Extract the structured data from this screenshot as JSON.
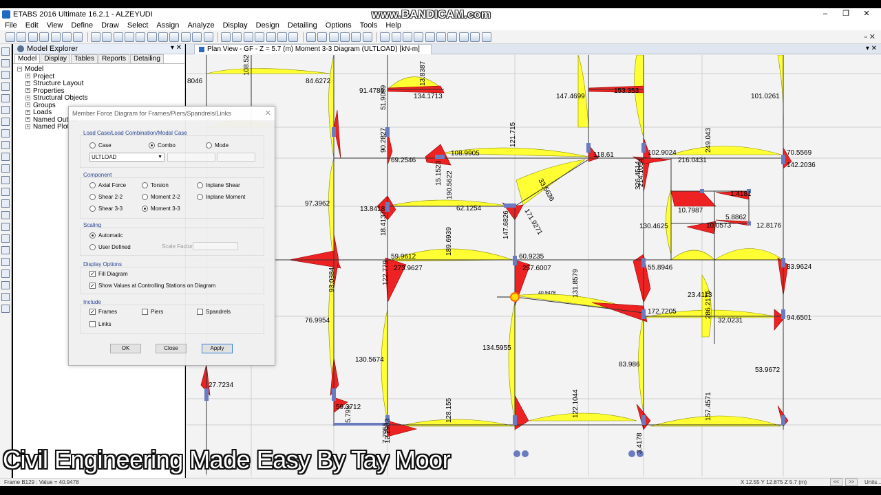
{
  "app": {
    "title": "ETABS 2016 Ultimate 16.2.1 - ALZEYUDI",
    "watermark": "www.BANDICAM.com",
    "window_controls": [
      "–",
      "❐",
      "✕"
    ]
  },
  "menu": [
    "File",
    "Edit",
    "View",
    "Define",
    "Draw",
    "Select",
    "Assign",
    "Analyze",
    "Display",
    "Design",
    "Detailing",
    "Options",
    "Tools",
    "Help"
  ],
  "explorer": {
    "title": "Model Explorer",
    "tabs": [
      "Model",
      "Display",
      "Tables",
      "Reports",
      "Detailing"
    ],
    "root": "Model",
    "items": [
      "Project",
      "Structure Layout",
      "Properties",
      "Structural Objects",
      "Groups",
      "Loads",
      "Named Output",
      "Named Plots"
    ]
  },
  "doc_tab": {
    "title": "Plan View - GF - Z = 5.7 (m)   Moment 3-3 Diagram   (ULTLOAD)  [kN-m]"
  },
  "dialog": {
    "title": "Member Force Diagram for Frames/Piers/Spandrels/Links",
    "load_case_group": "Load Case/Load Combination/Modal Case",
    "case_options": [
      "Case",
      "Combo",
      "Mode"
    ],
    "case_selected": "Combo",
    "combo_value": "ULTLOAD",
    "component_group": "Component",
    "component_options": [
      "Axial Force",
      "Torsion",
      "Inplane Shear",
      "Shear 2-2",
      "Moment 2-2",
      "Inplane Moment",
      "Shear 3-3",
      "Moment 3-3"
    ],
    "component_selected": "Moment 3-3",
    "scaling_group": "Scaling",
    "scaling_options": [
      "Automatic",
      "User Defined"
    ],
    "scaling_selected": "Automatic",
    "scale_factor_label": "Scale Factor",
    "display_group": "Display Options",
    "display_options": [
      {
        "label": "Fill Diagram",
        "checked": true
      },
      {
        "label": "Show Values at Controlling Stations on Diagram",
        "checked": true
      }
    ],
    "include_group": "Include",
    "include_options": [
      {
        "label": "Frames",
        "checked": true
      },
      {
        "label": "Piers",
        "checked": false
      },
      {
        "label": "Spandrels",
        "checked": false
      },
      {
        "label": "Links",
        "checked": false
      }
    ],
    "buttons": [
      "OK",
      "Close",
      "Apply"
    ]
  },
  "plot_labels": [
    "8046",
    "108.52",
    "84.6272",
    "91.4789",
    "13.8387",
    "134.1713",
    "147.4699",
    "153.353",
    "101.0261",
    "51.9089",
    "90.2827",
    "121.715",
    "249.043",
    "70.5569",
    "142.2036",
    "69.2546",
    "108.9905",
    "118.61",
    "102.9024",
    "216.0431",
    "33.5636",
    "15.1523",
    "97.3962",
    "13.8418",
    "62.1254",
    "190.5622",
    "326.4514",
    "214.1054",
    "1.4181",
    "10.7987",
    "5.8862",
    "10.0573",
    "12.8176",
    "130.4625",
    "147.6826",
    "171.9271",
    "59.9612",
    "273.9627",
    "60.9235",
    "257.6007",
    "55.8946",
    "33.9624",
    "189.6939",
    "122.779",
    "18.4137",
    "93.0384",
    "76.9954",
    "131.8579",
    "40.9478",
    "23.4113",
    "172.7205",
    "94.6501",
    "286.2176",
    "32.0231",
    "134.5955",
    "130.5674",
    "83.986",
    "53.9672",
    "27.7234",
    "59.3712",
    "5.795",
    "128.155",
    "122.1044",
    "157.4571",
    "7.7955",
    "3.4178",
    "12.2953"
  ],
  "caption": "Civil Engineering Made Easy By Tay Moor",
  "status": {
    "left": "Frame B129 : Value = 40.9478",
    "coords": "X 12.55  Y 12.875  Z 5.7 (m)",
    "nav": [
      "<<",
      ">>"
    ],
    "units": "Units..."
  },
  "colors": {
    "positive_moment": "#ffff33",
    "negative_moment": "#ee2222",
    "column": "#6a7bc0",
    "highlight": "#ff6b00"
  }
}
